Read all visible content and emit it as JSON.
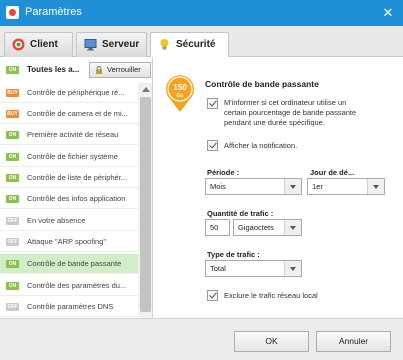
{
  "window": {
    "title": "Paramètres",
    "close_symbol": "✕"
  },
  "tabs": [
    {
      "label": "Client"
    },
    {
      "label": "Serveur"
    },
    {
      "label": "Sécurité"
    }
  ],
  "sidebar": {
    "header_label": "Toutes les a...",
    "lock_button": "Verrouiller",
    "items": [
      {
        "badge": "BUY",
        "label": "Contrôle de périphérique ré..."
      },
      {
        "badge": "BUY",
        "label": "Contrôle de camera et de mi..."
      },
      {
        "badge": "ON",
        "label": "Première activité de réseau"
      },
      {
        "badge": "ON",
        "label": "Contrôle de fichier système"
      },
      {
        "badge": "ON",
        "label": "Contrôle de liste de périphér..."
      },
      {
        "badge": "ON",
        "label": "Contrôle des infos application"
      },
      {
        "badge": "OFF",
        "label": "En votre absence"
      },
      {
        "badge": "OFF",
        "label": "Attaque \"ARP spoofing\""
      },
      {
        "badge": "ON",
        "label": "Contrôle de bande passante",
        "selected": true
      },
      {
        "badge": "ON",
        "label": "Contrôle des paramètres du..."
      },
      {
        "badge": "OFF",
        "label": "Contrôle paramètres DNS"
      }
    ]
  },
  "main": {
    "gauge_value": "150",
    "gauge_unit": "Go",
    "section_title": "Contrôle de bande passante",
    "notify_percent_line1": "M'informer si cet ordinateur utilise un",
    "notify_percent_line2": "certain pourcentage de bande passante",
    "notify_percent_line3": "pendant une durée spécifique.",
    "notify_percent_checked": true,
    "show_notification": "Afficher la notification.",
    "show_notification_checked": true,
    "period_label": "Période :",
    "period_value": "Mois",
    "day_label": "Jour de dé...",
    "day_value": "1er",
    "traffic_qty_label": "Quantité de trafic :",
    "traffic_qty_value": "50",
    "traffic_unit_value": "Gigaoctets",
    "traffic_type_label": "Type de trafic :",
    "traffic_type_value": "Total",
    "exclude_local": "Exclure le trafic réseau local",
    "exclude_local_checked": true
  },
  "footer": {
    "ok": "OK",
    "cancel": "Annuler"
  },
  "colors": {
    "titlebar": "#1f8fd8",
    "gauge": "#f6a21d",
    "selected_row": "#d2eec8",
    "badge_on": "#8bc34a",
    "badge_buy": "#ef8a3a",
    "badge_off": "#c9c9c9"
  }
}
